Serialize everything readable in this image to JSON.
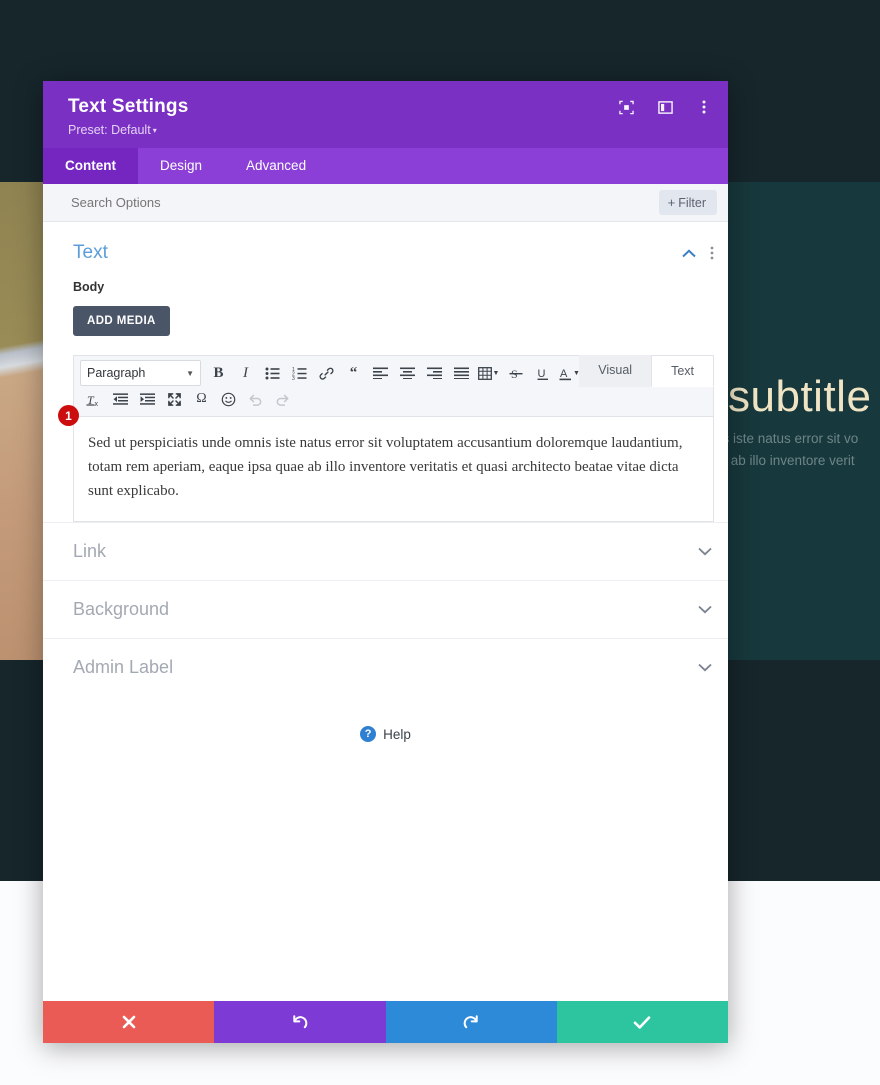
{
  "background": {
    "subtitle": "subtitle",
    "paragraph_line1": "nis iste natus error sit vo",
    "paragraph_line2": "ae ab illo inventore verit",
    "colors": {
      "dark": "#16262b",
      "teal_panel": "#17383c",
      "subtitle_color": "#efe4c4"
    }
  },
  "modal": {
    "title": "Text Settings",
    "preset": "Preset: Default",
    "preset_caret": "▾",
    "header_icons": [
      {
        "name": "focus-target-icon",
        "title": "Focus"
      },
      {
        "name": "panel-layout-icon",
        "title": "Layout"
      },
      {
        "name": "kebab-menu-icon",
        "title": "More"
      }
    ],
    "tabs": [
      {
        "label": "Content",
        "active": true
      },
      {
        "label": "Design",
        "active": false
      },
      {
        "label": "Advanced",
        "active": false
      }
    ],
    "search": {
      "placeholder": "Search Options",
      "value": ""
    },
    "filter_button": {
      "label": "Filter",
      "plus": "+"
    },
    "accent_color": "#7b30c4",
    "tabbar_color": "#8c3fd6"
  },
  "text_section": {
    "title": "Text",
    "collapse_icon": "chevron-up",
    "body_label": "Body",
    "add_media_label": "ADD MEDIA",
    "badge_number": "1",
    "editor": {
      "mode_tabs": [
        {
          "label": "Visual",
          "active": false
        },
        {
          "label": "Text",
          "active": true
        }
      ],
      "format_select": "Paragraph",
      "toolbar_row1": [
        "bold-icon",
        "italic-icon",
        "bulleted-list-icon",
        "numbered-list-icon",
        "link-icon",
        "blockquote-icon",
        "align-left-icon",
        "align-center-icon",
        "align-right-icon",
        "align-justify-icon",
        "table-icon",
        "strikethrough-icon",
        "underline-icon",
        "text-color-icon",
        "paste-as-text-icon"
      ],
      "toolbar_row2": [
        "clear-formatting-icon",
        "outdent-icon",
        "indent-icon",
        "fullscreen-icon",
        "special-character-icon",
        "emoji-icon",
        "undo-icon",
        "redo-icon"
      ],
      "content": "Sed ut perspiciatis unde omnis iste natus error sit voluptatem accusantium doloremque laudantium, totam rem aperiam, eaque ipsa quae ab illo inventore veritatis et quasi architecto beatae vitae dicta sunt explicabo."
    }
  },
  "accordions": [
    {
      "label": "Link",
      "icon": "chevron-down-icon"
    },
    {
      "label": "Background",
      "icon": "chevron-down-icon"
    },
    {
      "label": "Admin Label",
      "icon": "chevron-down-icon"
    }
  ],
  "help": {
    "label": "Help",
    "icon_char": "?"
  },
  "footer_buttons": [
    {
      "name": "close-button",
      "icon": "✖",
      "color": "#eb5b56"
    },
    {
      "name": "undo-button",
      "icon": "↺",
      "color": "#7e3ad4"
    },
    {
      "name": "redo-button",
      "icon": "↻",
      "color": "#2d8ad8"
    },
    {
      "name": "save-button",
      "icon": "✔",
      "color": "#2dc4a0"
    }
  ]
}
